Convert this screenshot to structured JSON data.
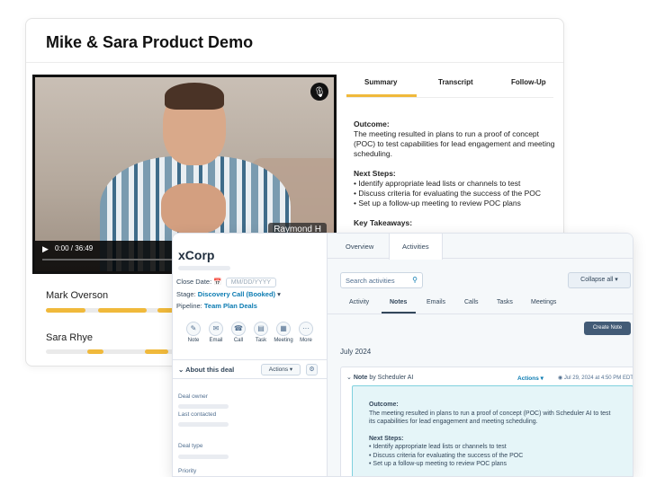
{
  "meeting": {
    "title": "Mike & Sara Product Demo",
    "video": {
      "time": "0:00 / 36:49",
      "participant_tag": "Raymond H",
      "icons": [
        "microphone-icon",
        "play-icon"
      ]
    },
    "speakers": [
      {
        "name": "Mark Overson"
      },
      {
        "name": "Sara Rhye"
      }
    ],
    "tabs": [
      {
        "label": "Summary",
        "active": true
      },
      {
        "label": "Transcript",
        "active": false
      },
      {
        "label": "Follow-Up",
        "active": false
      }
    ],
    "summary": {
      "outcome_title": "Outcome:",
      "outcome_text": "The meeting resulted in plans to run a proof of concept (POC) to test capabilities for lead engagement and meeting scheduling.",
      "next_steps_title": "Next Steps:",
      "next_steps": [
        "Identify appropriate lead lists or channels to test",
        "Discuss criteria for evaluating the success of the POC",
        "Set up a follow-up meeting to review POC plans"
      ],
      "key_takeaways_title": "Key Takeaways:"
    }
  },
  "crm": {
    "company": "xCorp",
    "close_date_label": "Close Date:",
    "close_date_placeholder": "MM/DD/YYYY",
    "stage_label": "Stage:",
    "stage_value": "Discovery Call (Booked)",
    "pipeline_label": "Pipeline:",
    "pipeline_value": "Team Plan Deals",
    "actions": [
      "Note",
      "Email",
      "Call",
      "Task",
      "Meeting",
      "More"
    ],
    "about_title": "About this deal",
    "about_actions": "Actions",
    "properties": [
      "Deal owner",
      "Last contacted",
      "Deal type",
      "Priority"
    ],
    "top_tabs": [
      {
        "label": "Overview",
        "active": false
      },
      {
        "label": "Activities",
        "active": true
      }
    ],
    "search_placeholder": "Search activities",
    "collapse_label": "Collapse all",
    "sub_tabs": [
      {
        "label": "Activity",
        "active": false
      },
      {
        "label": "Notes",
        "active": true
      },
      {
        "label": "Emails",
        "active": false
      },
      {
        "label": "Calls",
        "active": false
      },
      {
        "label": "Tasks",
        "active": false
      },
      {
        "label": "Meetings",
        "active": false
      }
    ],
    "create_note": "Create Note",
    "month": "July 2024",
    "note": {
      "type": "Note",
      "by": "by Scheduler AI",
      "actions": "Actions",
      "timestamp": "Jul 29, 2024 at 4:50 PM EDT",
      "outcome_title": "Outcome:",
      "outcome_text": "The meeting resulted in plans to run a proof of concept (POC) with Scheduler AI to test its capabilities for lead engagement and meeting scheduling.",
      "next_steps_title": "Next Steps:",
      "next_steps": [
        "Identify appropriate lead lists or channels to test",
        "Discuss criteria for evaluating the success of the POC",
        "Set up a follow-up meeting to review POC plans"
      ]
    }
  }
}
